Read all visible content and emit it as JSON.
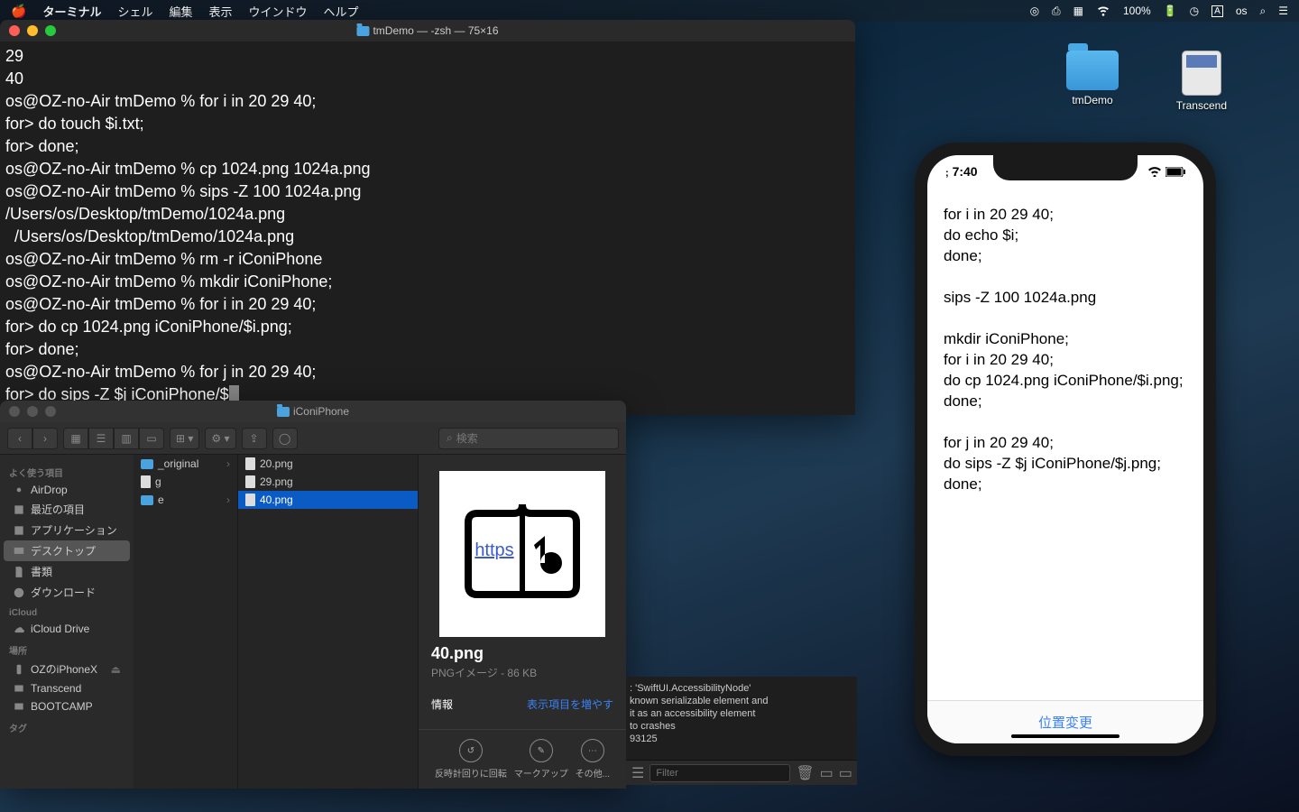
{
  "menubar": {
    "app": "ターミナル",
    "items": [
      "シェル",
      "編集",
      "表示",
      "ウインドウ",
      "ヘルプ"
    ],
    "battery": "100%",
    "user": "os"
  },
  "terminal": {
    "title": "tmDemo — -zsh — 75×16",
    "lines": [
      "29",
      "40",
      "os@OZ-no-Air tmDemo % for i in 20 29 40;",
      "for> do touch $i.txt;",
      "for> done;",
      "os@OZ-no-Air tmDemo % cp 1024.png 1024a.png",
      "os@OZ-no-Air tmDemo % sips -Z 100 1024a.png",
      "/Users/os/Desktop/tmDemo/1024a.png",
      "  /Users/os/Desktop/tmDemo/1024a.png",
      "os@OZ-no-Air tmDemo % rm -r iConiPhone",
      "os@OZ-no-Air tmDemo % mkdir iConiPhone;",
      "os@OZ-no-Air tmDemo % for i in 20 29 40;",
      "for> do cp 1024.png iConiPhone/$i.png;",
      "for> done;",
      "os@OZ-no-Air tmDemo % for j in 20 29 40;",
      "for> do sips -Z $j iConiPhone/$"
    ]
  },
  "finder": {
    "title": "iConiPhone",
    "search_placeholder": "検索",
    "sidebar": {
      "fav_head": "よく使う項目",
      "fav": [
        "AirDrop",
        "最近の項目",
        "アプリケーション",
        "デスクトップ",
        "書類",
        "ダウンロード"
      ],
      "icloud_head": "iCloud",
      "icloud": [
        "iCloud Drive"
      ],
      "loc_head": "場所",
      "loc": [
        "OZのiPhoneX",
        "Transcend",
        "BOOTCAMP"
      ],
      "tag_head": "タグ"
    },
    "col1": [
      "_original",
      "g",
      "e"
    ],
    "col2": [
      "20.png",
      "29.png",
      "40.png"
    ],
    "selected": "40.png",
    "preview": {
      "name": "40.png",
      "sub": "PNGイメージ - 86 KB",
      "info": "情報",
      "more": "表示項目を増やす",
      "act1": "反時計回りに回転",
      "act2": "マークアップ",
      "act3": "その他..."
    }
  },
  "xcode": {
    "lines": [
      ": 'SwiftUI.AccessibilityNode'",
      "known serializable element and",
      "it as an accessibility element",
      "to crashes",
      "93125"
    ],
    "filter": "Filter"
  },
  "phone": {
    "time": "7:40",
    "note_lines": [
      "for i in 20 29 40;",
      "do echo $i;",
      "done;",
      "",
      "sips -Z 100 1024a.png",
      "",
      "mkdir iConiPhone;",
      "for i in 20 29 40;",
      "do cp 1024.png iConiPhone/$i.png;",
      "done;",
      "",
      "for j in 20 29 40;",
      "do sips -Z $j iConiPhone/$j.png;",
      "done;"
    ],
    "tab": "位置変更"
  },
  "desktop": {
    "folder": "tmDemo",
    "drive": "Transcend"
  }
}
